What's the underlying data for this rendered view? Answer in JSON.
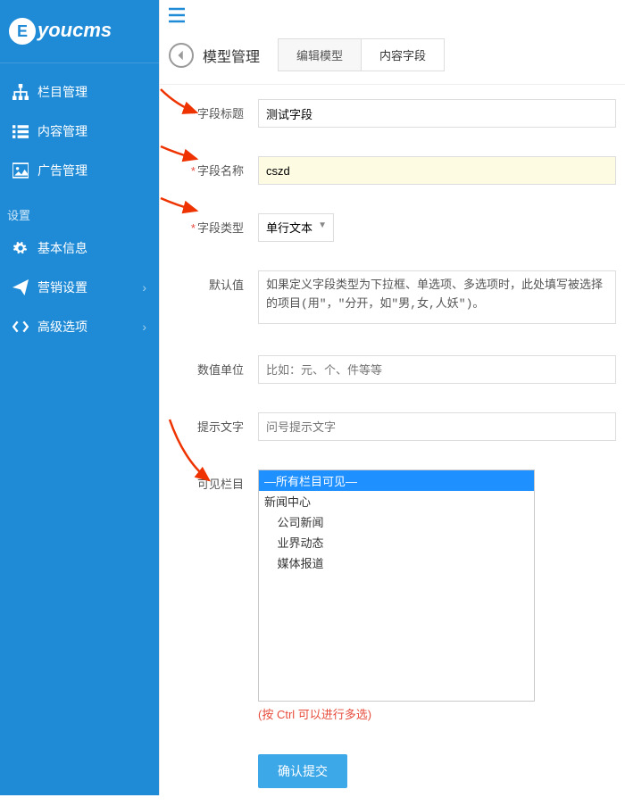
{
  "brand": "youcms",
  "sidebar": {
    "items": [
      {
        "label": "栏目管理",
        "icon": "sitemap-icon"
      },
      {
        "label": "内容管理",
        "icon": "list-icon"
      },
      {
        "label": "广告管理",
        "icon": "image-icon"
      }
    ],
    "settings_heading": "设置",
    "settings": [
      {
        "label": "基本信息",
        "icon": "gear-icon",
        "expandable": false
      },
      {
        "label": "营销设置",
        "icon": "send-icon",
        "expandable": true
      },
      {
        "label": "高级选项",
        "icon": "code-icon",
        "expandable": true
      }
    ]
  },
  "header": {
    "title": "模型管理",
    "tabs": [
      {
        "label": "编辑模型",
        "active": false
      },
      {
        "label": "内容字段",
        "active": true
      }
    ]
  },
  "form": {
    "field_title": {
      "label": "字段标题",
      "required": true,
      "value": "测试字段"
    },
    "field_name": {
      "label": "字段名称",
      "required": true,
      "value": "cszd"
    },
    "field_type": {
      "label": "字段类型",
      "required": true,
      "selected": "单行文本"
    },
    "default_value": {
      "label": "默认值",
      "text": "如果定义字段类型为下拉框、单选项、多选项时，此处填写被选择的项目(用\"，\"分开，如\"男,女,人妖\")。"
    },
    "unit": {
      "label": "数值单位",
      "placeholder": "比如：元、个、件等等"
    },
    "tip_text": {
      "label": "提示文字",
      "placeholder": "问号提示文字"
    },
    "visible_columns": {
      "label": "可见栏目",
      "options": [
        {
          "text": "—所有栏目可见—",
          "indent": 0,
          "selected": true
        },
        {
          "text": "新闻中心",
          "indent": 0,
          "selected": false
        },
        {
          "text": "公司新闻",
          "indent": 1,
          "selected": false
        },
        {
          "text": "业界动态",
          "indent": 1,
          "selected": false
        },
        {
          "text": "媒体报道",
          "indent": 1,
          "selected": false
        }
      ],
      "hint": "(按 Ctrl 可以进行多选)"
    },
    "submit_label": "确认提交"
  }
}
